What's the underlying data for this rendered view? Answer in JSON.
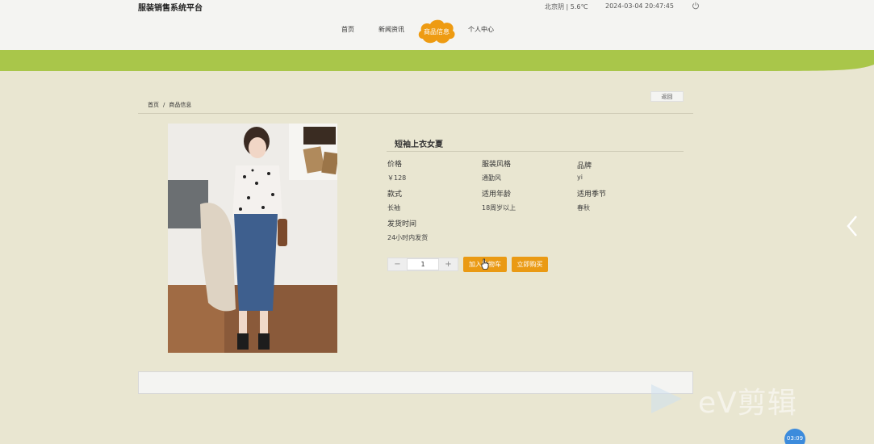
{
  "header": {
    "site_title": "服装销售系统平台",
    "weather": "北京阴 | 5.6℃",
    "datetime": "2024-03-04  20:47:45"
  },
  "nav": {
    "items": [
      {
        "label": "首页"
      },
      {
        "label": "新闻资讯"
      },
      {
        "label": "商品信息",
        "active": true
      },
      {
        "label": "个人中心"
      }
    ]
  },
  "breadcrumb": {
    "home": "首页",
    "separator": "/",
    "current": "商品信息"
  },
  "back_label": "返回",
  "product": {
    "name": "短袖上衣女夏",
    "attributes": [
      {
        "label": "价格",
        "value": "￥128"
      },
      {
        "label": "服装风格",
        "value": "通勤风"
      },
      {
        "label": "品牌",
        "value": "yi"
      },
      {
        "label": "款式",
        "value": "长袖"
      },
      {
        "label": "适用年龄",
        "value": "18周岁以上"
      },
      {
        "label": "适用季节",
        "value": "春秋"
      },
      {
        "label": "发货时间",
        "value": "24小时内发货"
      }
    ]
  },
  "purchase": {
    "minus": "−",
    "plus": "+",
    "quantity": "1",
    "add_to_cart": "加入购物车",
    "buy_now": "立即购买"
  },
  "overlay": {
    "watermark": "eV剪辑",
    "time_badge": "03:09"
  },
  "colors": {
    "background": "#e9e6d1",
    "green_band": "#a9c64a",
    "accent_orange": "#ea9a14"
  },
  "icons": {
    "power": "power-icon",
    "carousel": "chevron-left-icon",
    "cursor": "hand-pointer-icon"
  }
}
